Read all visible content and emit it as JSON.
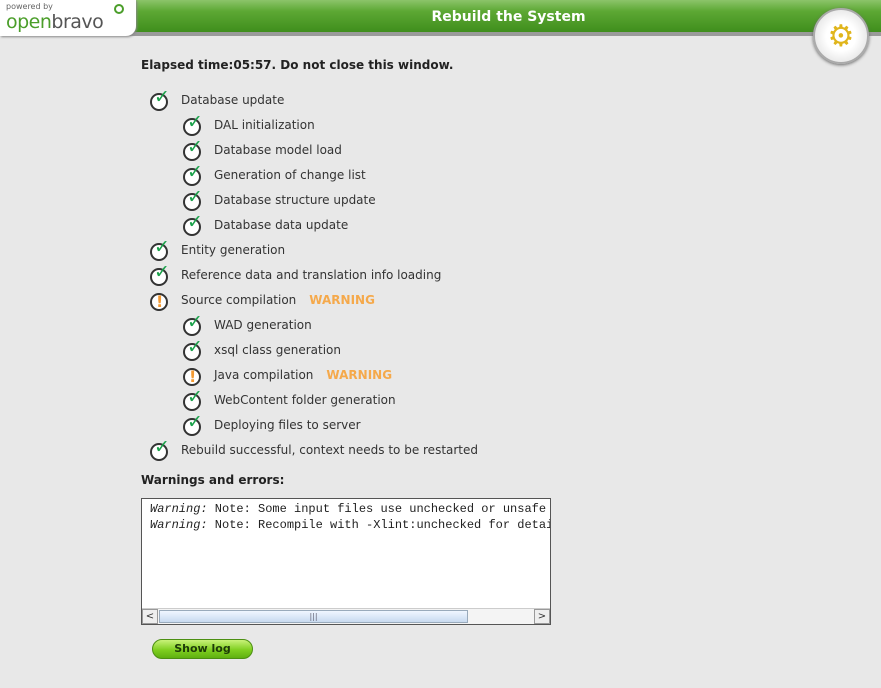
{
  "header": {
    "logo_powered": "powered by",
    "logo_open": "open",
    "logo_bravo": "bravo",
    "title": "Rebuild the System"
  },
  "elapsed": "Elapsed time:05:57. Do not close this window.",
  "steps": [
    {
      "label": "Database update",
      "status": "ok",
      "level": 0
    },
    {
      "label": "DAL initialization",
      "status": "ok",
      "level": 1
    },
    {
      "label": "Database model load",
      "status": "ok",
      "level": 1
    },
    {
      "label": "Generation of change list",
      "status": "ok",
      "level": 1
    },
    {
      "label": "Database structure update",
      "status": "ok",
      "level": 1
    },
    {
      "label": "Database data update",
      "status": "ok",
      "level": 1
    },
    {
      "label": "Entity generation",
      "status": "ok",
      "level": 0
    },
    {
      "label": "Reference data and translation info loading",
      "status": "ok",
      "level": 0
    },
    {
      "label": "Source compilation",
      "status": "warning",
      "level": 0
    },
    {
      "label": "WAD generation",
      "status": "ok",
      "level": 1
    },
    {
      "label": "xsql class generation",
      "status": "ok",
      "level": 1
    },
    {
      "label": "Java compilation",
      "status": "warning",
      "level": 1
    },
    {
      "label": "WebContent folder generation",
      "status": "ok",
      "level": 1
    },
    {
      "label": "Deploying files to server",
      "status": "ok",
      "level": 1
    },
    {
      "label": "Rebuild successful, context needs to be restarted",
      "status": "ok",
      "level": 0
    }
  ],
  "warning_label": "WARNING",
  "warnings_heading": "Warnings and errors:",
  "warnings": [
    {
      "prefix": "Warning:",
      "text": " Note: Some input files use unchecked or unsafe operations."
    },
    {
      "prefix": "Warning:",
      "text": " Note: Recompile with -Xlint:unchecked for details."
    }
  ],
  "show_log": "Show log"
}
